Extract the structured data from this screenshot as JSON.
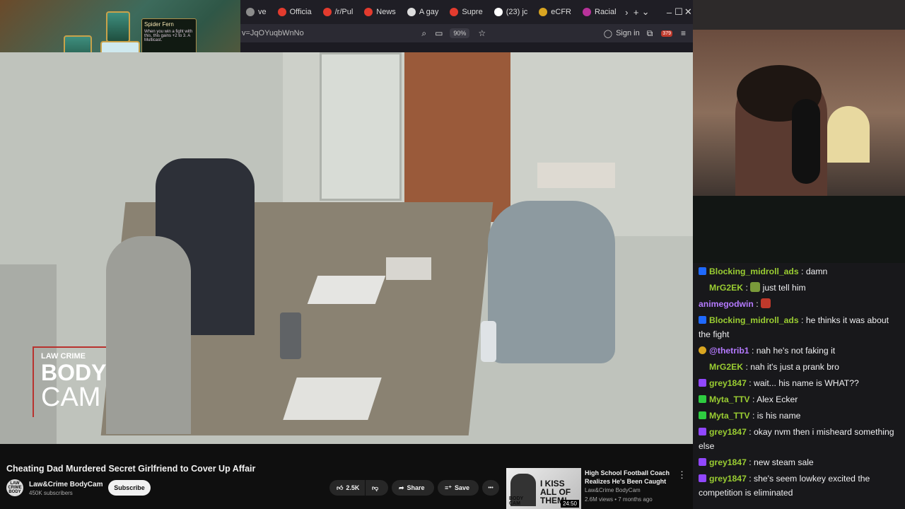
{
  "browser": {
    "tabs": [
      {
        "label": "ve",
        "color": "#8c8c8c"
      },
      {
        "label": "Officia",
        "color": "#e33b2e"
      },
      {
        "label": "/r/Pul",
        "color": "#e33b2e"
      },
      {
        "label": "News",
        "color": "#e33b2e"
      },
      {
        "label": "A gay",
        "color": "#dddddd"
      },
      {
        "label": "Supre",
        "color": "#e33b2e"
      },
      {
        "label": "(23) jc",
        "color": "#ffffff"
      },
      {
        "label": "eCFR",
        "color": "#d9a521"
      },
      {
        "label": "Racial",
        "color": "#b8329a"
      }
    ],
    "tab_scroll": "›",
    "new_tab": "+",
    "tab_list": "⌄",
    "minimize": "–",
    "maximize": "☐",
    "close": "✕",
    "url": "v=JqOYuqbWnNo",
    "zoom": "90%",
    "sign_in": "Sign in",
    "notif_count": "379"
  },
  "game": {
    "card_name": "Spider Fern",
    "card_text": "When you win a fight with this, this gains +2 to 3. A Multicast."
  },
  "video": {
    "watermark_top": "LAW CRIME",
    "watermark_body": "BODY",
    "watermark_cam": "CAM",
    "title": "Cheating Dad Murdered Secret Girlfriend to Cover Up Affair",
    "channel": "Law&Crime BodyCam",
    "subscribers": "450K subscribers",
    "subscribe": "Subscribe",
    "likes": "2.5K",
    "share": "Share",
    "save": "Save",
    "more": "•••",
    "avatar_text": "LAW CRIME BODY"
  },
  "recommendation": {
    "thumb_text": "I KISS ALL OF THEM!",
    "thumb_small": "BODY CAM",
    "duration": "24:50",
    "title": "High School Football Coach Realizes He's Been Caught",
    "channel": "Law&Crime BodyCam",
    "meta": "2.6M views • 7 months ago"
  },
  "chat": {
    "messages": [
      {
        "badge": "#1f69ff",
        "user": "Blocking_midroll_ads",
        "color": "#9acd32",
        "text": "damn",
        "emote": ""
      },
      {
        "badge": "",
        "user": "MrG2EK",
        "color": "#9acd32",
        "text": "just tell him",
        "emote": "#7a9a3a"
      },
      {
        "badge": "",
        "user": "animegodwin",
        "color": "#b57aff",
        "text": "",
        "emote": "#c0392b"
      },
      {
        "badge": "#1f69ff",
        "user": "Blocking_midroll_ads",
        "color": "#9acd32",
        "text": "he thinks it was about the fight",
        "emote": ""
      },
      {
        "badge": "#d9a521",
        "user": "@thetrib1",
        "color": "#b57aff",
        "text": "nah he's not faking it",
        "emote": ""
      },
      {
        "badge": "",
        "user": "MrG2EK",
        "color": "#9acd32",
        "text": "nah it's just a prank bro",
        "emote": ""
      },
      {
        "badge": "#9147ff",
        "user": "grey1847",
        "color": "#9acd32",
        "text": "wait... his name is WHAT??",
        "emote": ""
      },
      {
        "badge": "#2ecc40",
        "user": "Myta_TTV",
        "color": "#9acd32",
        "text": "Alex Ecker",
        "emote": ""
      },
      {
        "badge": "#2ecc40",
        "user": "Myta_TTV",
        "color": "#9acd32",
        "text": "is his name",
        "emote": ""
      },
      {
        "badge": "#9147ff",
        "user": "grey1847",
        "color": "#9acd32",
        "text": "okay nvm then i misheard something else",
        "emote": ""
      },
      {
        "badge": "#9147ff",
        "user": "grey1847",
        "color": "#9acd32",
        "text": "new steam sale",
        "emote": ""
      },
      {
        "badge": "#9147ff",
        "user": "grey1847",
        "color": "#9acd32",
        "text": "she's seem lowkey excited the competition is eliminated",
        "emote": ""
      }
    ]
  }
}
